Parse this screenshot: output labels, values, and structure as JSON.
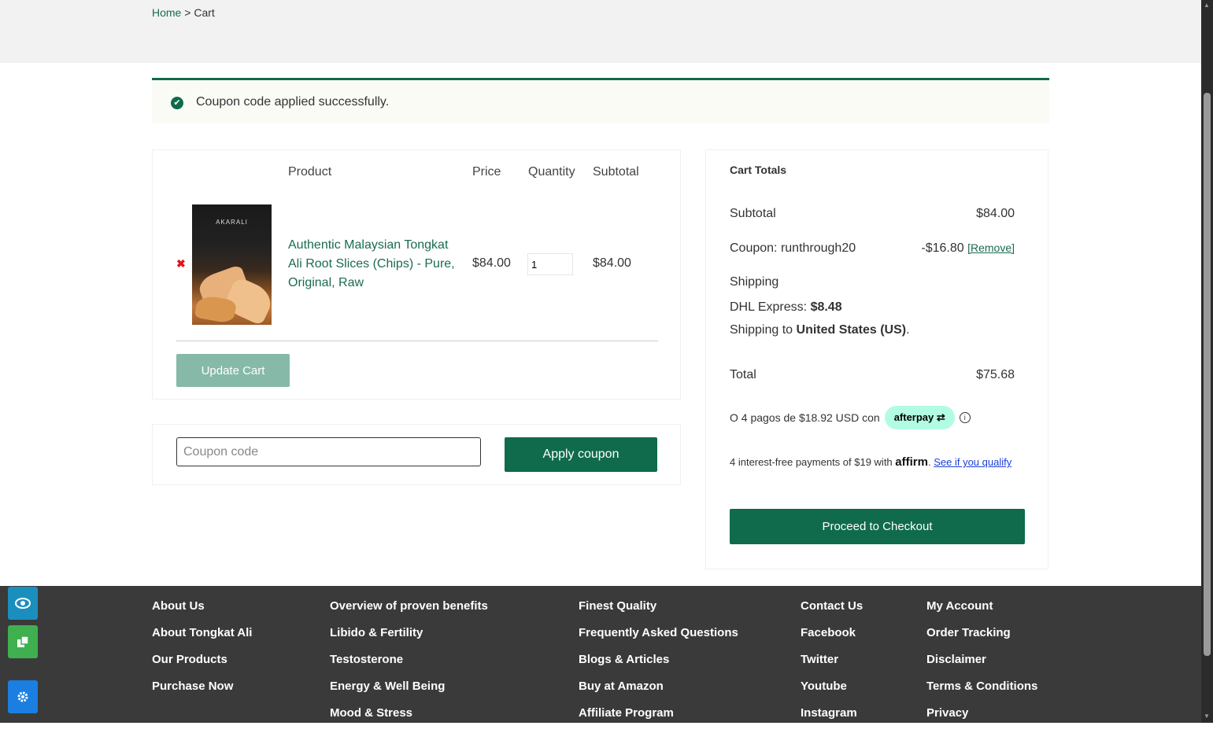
{
  "breadcrumb": {
    "home": "Home",
    "separator": ">",
    "current": "Cart"
  },
  "notice": {
    "message": "Coupon code applied successfully."
  },
  "cart": {
    "headers": {
      "product": "Product",
      "price": "Price",
      "quantity": "Quantity",
      "subtotal": "Subtotal"
    },
    "item": {
      "thumbnail_brand": "AKARALI",
      "name": "Authentic Malaysian Tongkat Ali Root Slices (Chips) - Pure, Original, Raw",
      "price": "$84.00",
      "quantity": "1",
      "subtotal": "$84.00"
    },
    "update_label": "Update Cart"
  },
  "coupon": {
    "placeholder": "Coupon code",
    "apply_label": "Apply coupon"
  },
  "totals": {
    "title": "Cart Totals",
    "subtotal_label": "Subtotal",
    "subtotal_value": "$84.00",
    "coupon_label": "Coupon: runthrough20",
    "coupon_value": "-$16.80",
    "coupon_remove": "[Remove]",
    "shipping_label": "Shipping",
    "shipping_method": "DHL Express:",
    "shipping_cost": "$8.48",
    "shipping_to": "Shipping to",
    "shipping_country": "United States (US)",
    "total_label": "Total",
    "total_value": "$75.68",
    "afterpay_text": "O 4 pagos de $18.92 USD con",
    "afterpay_logo": "afterpay",
    "affirm_text": "4 interest-free payments of $19 with",
    "affirm_logo": "affirm",
    "affirm_link": "See if you qualify",
    "checkout_label": "Proceed to Checkout"
  },
  "footer": {
    "col1": [
      "About Us",
      "About Tongkat Ali",
      "Our Products",
      "Purchase Now"
    ],
    "col2": [
      "Overview of proven benefits",
      "Libido & Fertility",
      "Testosterone",
      "Energy & Well Being",
      "Mood & Stress"
    ],
    "col3": [
      "Finest Quality",
      "Frequently Asked Questions",
      "Blogs & Articles",
      "Buy at Amazon",
      "Affiliate Program"
    ],
    "col4": [
      "Contact Us",
      "Facebook",
      "Twitter",
      "Youtube",
      "Instagram"
    ],
    "col5": [
      "My Account",
      "Order Tracking",
      "Disclaimer",
      "Terms & Conditions",
      "Privacy"
    ]
  },
  "colors": {
    "brand_green": "#0f6b4c",
    "link_green": "#1a6b50",
    "footer_bg": "#3a3a3a",
    "afterpay_mint": "#b2fce4"
  },
  "icons": {
    "notice": "check-circle-icon",
    "remove": "remove-x-icon",
    "accessibility": "eye-icon",
    "copy": "copy-icon",
    "settings": "gear-icon"
  }
}
